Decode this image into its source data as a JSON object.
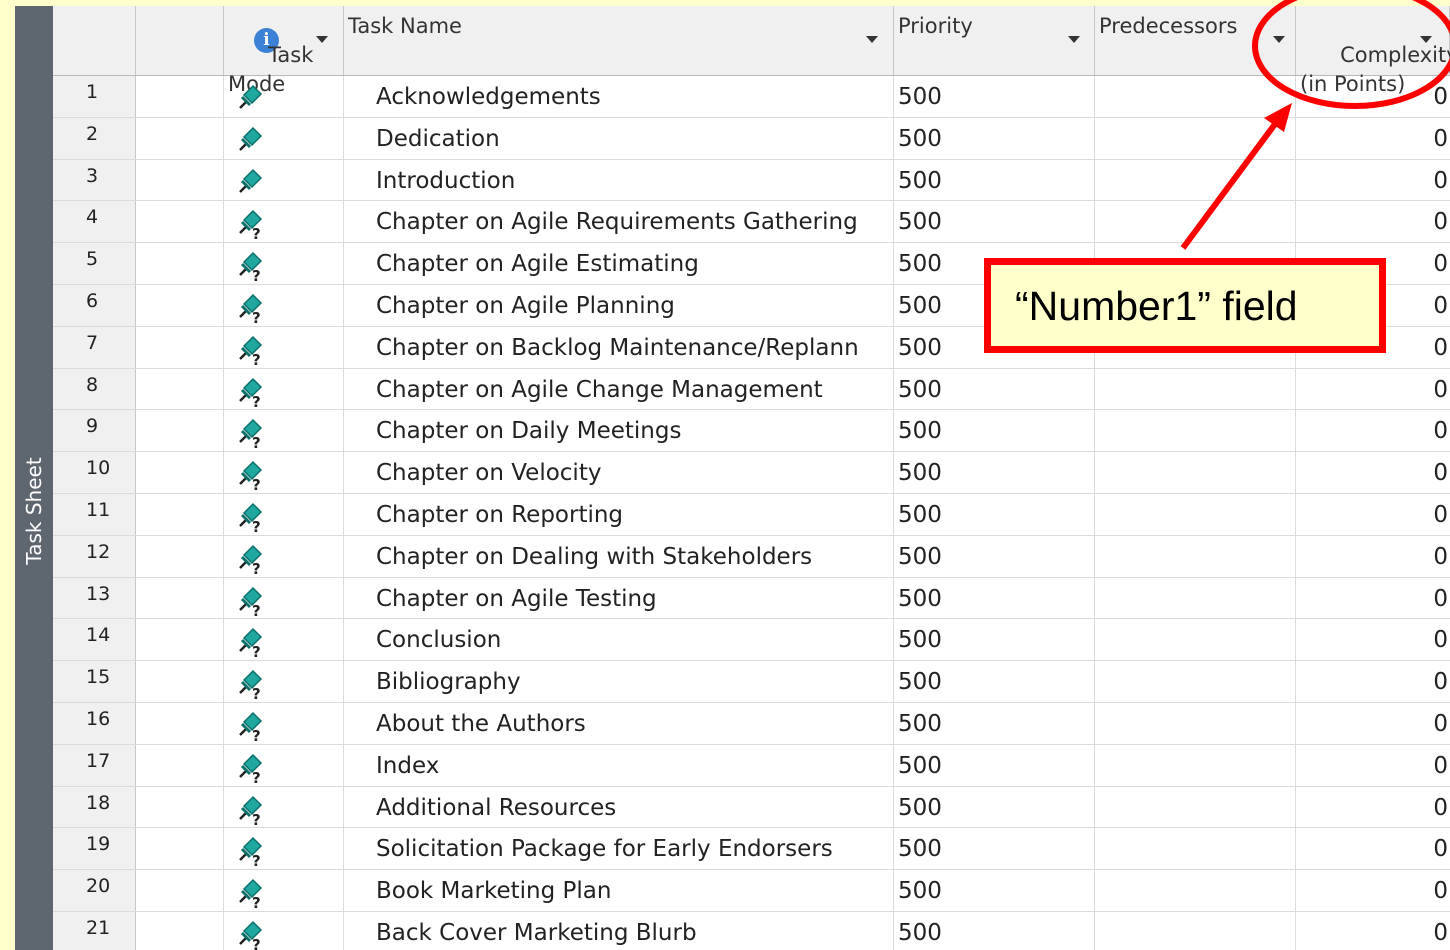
{
  "sidebar": {
    "label": "Task Sheet"
  },
  "columns": {
    "info": "i",
    "task_mode": "Task\nMode",
    "task_name": "Task Name",
    "priority": "Priority",
    "predecessors": "Predecessors",
    "complexity": "Complexity\n(in Points)"
  },
  "rows": [
    {
      "id": "1",
      "name": "Acknowledgements",
      "priority": "500",
      "complexity": "0",
      "mode_icon": "manual-pin-icon"
    },
    {
      "id": "2",
      "name": "Dedication",
      "priority": "500",
      "complexity": "0",
      "mode_icon": "manual-pin-icon"
    },
    {
      "id": "3",
      "name": "Introduction",
      "priority": "500",
      "complexity": "0",
      "mode_icon": "manual-pin-icon"
    },
    {
      "id": "4",
      "name": "Chapter on Agile Requirements Gathering",
      "priority": "500",
      "complexity": "0",
      "mode_icon": "manual-pin-question-icon"
    },
    {
      "id": "5",
      "name": "Chapter on Agile Estimating",
      "priority": "500",
      "complexity": "0",
      "mode_icon": "manual-pin-question-icon"
    },
    {
      "id": "6",
      "name": "Chapter on Agile Planning",
      "priority": "500",
      "complexity": "0",
      "mode_icon": "manual-pin-question-icon"
    },
    {
      "id": "7",
      "name": "Chapter on Backlog Maintenance/Replann",
      "priority": "500",
      "complexity": "0",
      "mode_icon": "manual-pin-question-icon"
    },
    {
      "id": "8",
      "name": "Chapter on Agile Change Management",
      "priority": "500",
      "complexity": "0",
      "mode_icon": "manual-pin-question-icon"
    },
    {
      "id": "9",
      "name": "Chapter on Daily Meetings",
      "priority": "500",
      "complexity": "0",
      "mode_icon": "manual-pin-question-icon"
    },
    {
      "id": "10",
      "name": "Chapter on Velocity",
      "priority": "500",
      "complexity": "0",
      "mode_icon": "manual-pin-question-icon"
    },
    {
      "id": "11",
      "name": "Chapter on Reporting",
      "priority": "500",
      "complexity": "0",
      "mode_icon": "manual-pin-question-icon"
    },
    {
      "id": "12",
      "name": "Chapter on Dealing with Stakeholders",
      "priority": "500",
      "complexity": "0",
      "mode_icon": "manual-pin-question-icon"
    },
    {
      "id": "13",
      "name": "Chapter on Agile Testing",
      "priority": "500",
      "complexity": "0",
      "mode_icon": "manual-pin-question-icon"
    },
    {
      "id": "14",
      "name": "Conclusion",
      "priority": "500",
      "complexity": "0",
      "mode_icon": "manual-pin-question-icon"
    },
    {
      "id": "15",
      "name": "Bibliography",
      "priority": "500",
      "complexity": "0",
      "mode_icon": "manual-pin-question-icon"
    },
    {
      "id": "16",
      "name": "About the Authors",
      "priority": "500",
      "complexity": "0",
      "mode_icon": "manual-pin-question-icon"
    },
    {
      "id": "17",
      "name": "Index",
      "priority": "500",
      "complexity": "0",
      "mode_icon": "manual-pin-question-icon"
    },
    {
      "id": "18",
      "name": "Additional Resources",
      "priority": "500",
      "complexity": "0",
      "mode_icon": "manual-pin-question-icon"
    },
    {
      "id": "19",
      "name": "Solicitation Package for Early Endorsers",
      "priority": "500",
      "complexity": "0",
      "mode_icon": "manual-pin-question-icon"
    },
    {
      "id": "20",
      "name": "Book Marketing Plan",
      "priority": "500",
      "complexity": "0",
      "mode_icon": "manual-pin-question-icon"
    },
    {
      "id": "21",
      "name": "Back Cover Marketing Blurb",
      "priority": "500",
      "complexity": "0",
      "mode_icon": "manual-pin-question-icon"
    }
  ],
  "annotation": {
    "callout": "“Number1” field",
    "color": "#FF0000"
  },
  "colors": {
    "background": "#FFFFCC",
    "sidebar": "#5E6670",
    "pin": "#1FA7A0"
  }
}
